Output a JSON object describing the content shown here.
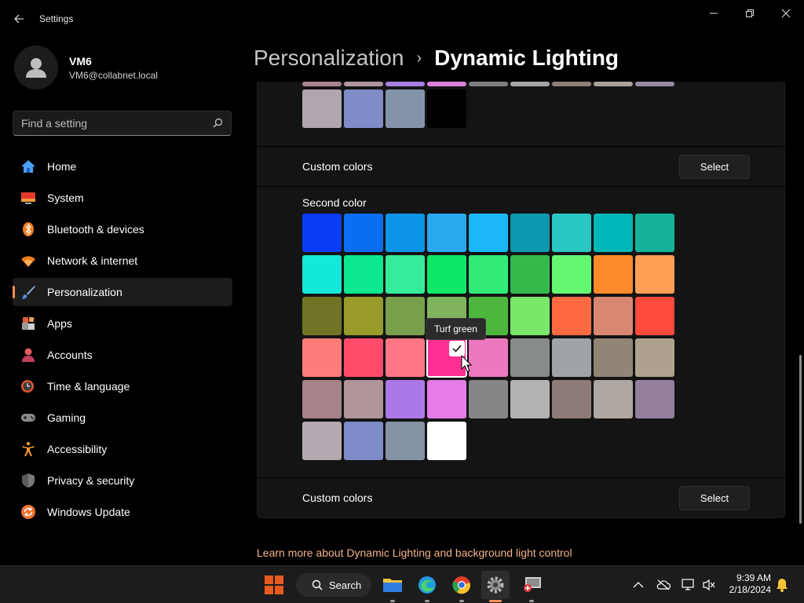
{
  "window": {
    "title": "Settings"
  },
  "profile": {
    "name": "VM6",
    "email": "VM6@collabnet.local"
  },
  "search": {
    "placeholder": "Find a setting"
  },
  "nav": {
    "items": [
      {
        "label": "Home",
        "icon": "home-icon"
      },
      {
        "label": "System",
        "icon": "system-icon"
      },
      {
        "label": "Bluetooth & devices",
        "icon": "bluetooth-icon"
      },
      {
        "label": "Network & internet",
        "icon": "wifi-icon"
      },
      {
        "label": "Personalization",
        "icon": "brush-icon",
        "active": true
      },
      {
        "label": "Apps",
        "icon": "apps-icon"
      },
      {
        "label": "Accounts",
        "icon": "accounts-icon"
      },
      {
        "label": "Time & language",
        "icon": "time-language-icon"
      },
      {
        "label": "Gaming",
        "icon": "gaming-icon"
      },
      {
        "label": "Accessibility",
        "icon": "accessibility-icon"
      },
      {
        "label": "Privacy & security",
        "icon": "shield-icon"
      },
      {
        "label": "Windows Update",
        "icon": "update-icon"
      }
    ]
  },
  "breadcrumb": {
    "parent": "Personalization",
    "current": "Dynamic Lighting"
  },
  "first_color": {
    "partial_row": [
      "#a8828f",
      "#b0979f",
      "#a97fe0",
      "#d97fdc",
      "#7d7d7d",
      "#a5a5a5",
      "#8f7f79",
      "#a8a29a",
      "#988aa3"
    ],
    "last_row": [
      "#b0a6ad",
      "#7f8cc6",
      "#8494a8",
      "#000000"
    ]
  },
  "custom_colors_1": {
    "label": "Custom colors",
    "button": "Select"
  },
  "second_color": {
    "label": "Second color",
    "rows": [
      [
        "#0a3df5",
        "#0a6ef0",
        "#0b94e8",
        "#2aa8f0",
        "#1ab8f7",
        "#0e98b0",
        "#2bc7c2",
        "#00b7b7",
        "#14b39a"
      ],
      [
        "#14e8d8",
        "#0ae88f",
        "#35ec9b",
        "#0ee867",
        "#31eb78",
        "#34ba4b",
        "#64f770",
        "#ff8a2a",
        "#ff9e55"
      ],
      [
        "#6f7425",
        "#989b2a",
        "#779f4c",
        "#7fb35e",
        "#4eb63d",
        "#79e76a",
        "#ff6a45",
        "#d88872",
        "#ff4a3c"
      ],
      [
        "#ff7c7b",
        "#ff4b6a",
        "#ff7686",
        "#ff2f93",
        "#ec79bf",
        "#878b8b",
        "#a0a4a7",
        "#918676",
        "#aea28f"
      ],
      [
        "#a68289",
        "#b0959b",
        "#ab78e9",
        "#e57ce7",
        "#858585",
        "#b2b2b2",
        "#8e7b78",
        "#aea6a0",
        "#947f9d"
      ],
      [
        "#b5a9b1",
        "#7d8cc8",
        "#8692a6",
        "#ffffff"
      ]
    ],
    "selected": {
      "row": 3,
      "col": 3
    }
  },
  "tooltip": {
    "text": "Turf green"
  },
  "custom_colors_2": {
    "label": "Custom colors",
    "button": "Select"
  },
  "learn_more": {
    "text": "Learn more about Dynamic Lighting and background light control"
  },
  "taskbar": {
    "search_label": "Search",
    "apps": [
      "file-explorer-icon",
      "edge-icon",
      "chrome-icon",
      "settings-icon",
      "remote-desktop-icon"
    ],
    "tray": [
      "chevron-up-icon",
      "cloud-off-icon",
      "network-icon",
      "volume-mute-icon",
      "bell-icon"
    ],
    "time": "9:39 AM",
    "date": "2/18/2024"
  },
  "colors": {
    "accent": "#ff8f5c",
    "link": "#f2b28b"
  }
}
